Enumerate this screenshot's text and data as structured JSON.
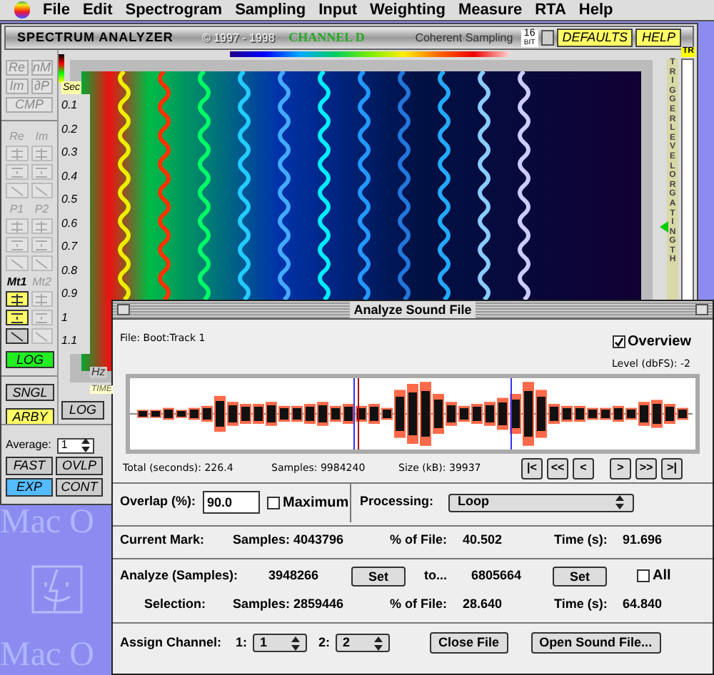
{
  "menu_bar": {
    "items": [
      "File",
      "Edit",
      "Spectrogram",
      "Sampling",
      "Input",
      "Weighting",
      "Measure",
      "RTA",
      "Help"
    ]
  },
  "analyzer": {
    "title": "SPECTRUM ANALYZER",
    "copyright": "© 1997 - 1998",
    "channel": "CHANNEL D",
    "mode": "Coherent Sampling",
    "bits": [
      "16",
      "BIT"
    ],
    "buttons": [
      "DEFAULTS",
      "HELP"
    ],
    "top_buttons": [
      [
        {
          "label": "Re",
          "disabled": true
        },
        {
          "label": "nM",
          "disabled": true
        }
      ],
      [
        {
          "label": "Im",
          "disabled": true
        },
        {
          "label": "∂P",
          "disabled": true
        }
      ],
      [
        {
          "label": "CMP",
          "disabled": true
        }
      ]
    ],
    "groups": [
      {
        "labels": [
          {
            "text": "Re",
            "disabled": true
          },
          {
            "text": "Im",
            "disabled": true
          }
        ],
        "rows": [
          [
            {
              "kind": "cross",
              "disabled": true,
              "on": false
            },
            {
              "kind": "cross",
              "disabled": true,
              "on": false
            }
          ],
          [
            {
              "kind": "dot",
              "disabled": true,
              "on": false
            },
            {
              "kind": "dot",
              "disabled": true,
              "on": false
            }
          ],
          [
            {
              "kind": "ramp",
              "disabled": true,
              "on": false
            },
            {
              "kind": "ramp",
              "disabled": true,
              "on": false
            }
          ]
        ]
      },
      {
        "labels": [
          {
            "text": "P1",
            "disabled": true
          },
          {
            "text": "P2",
            "disabled": true
          }
        ],
        "rows": [
          [
            {
              "kind": "cross",
              "disabled": true,
              "on": false
            },
            {
              "kind": "cross",
              "disabled": true,
              "on": false
            }
          ],
          [
            {
              "kind": "dot",
              "disabled": true,
              "on": false
            },
            {
              "kind": "dot",
              "disabled": true,
              "on": false
            }
          ],
          [
            {
              "kind": "ramp",
              "disabled": true,
              "on": false
            },
            {
              "kind": "ramp",
              "disabled": true,
              "on": false
            }
          ]
        ]
      },
      {
        "labels": [
          {
            "text": "Mt1",
            "disabled": false
          },
          {
            "text": "Mt2",
            "disabled": true
          }
        ],
        "rows": [
          [
            {
              "kind": "cross",
              "disabled": false,
              "on": true
            },
            {
              "kind": "cross",
              "disabled": true,
              "on": false
            }
          ],
          [
            {
              "kind": "dot",
              "disabled": false,
              "on": true
            },
            {
              "kind": "dot",
              "disabled": true,
              "on": false
            }
          ],
          [
            {
              "kind": "ramp",
              "disabled": false,
              "on": false
            },
            {
              "kind": "ramp",
              "disabled": true,
              "on": false
            }
          ]
        ]
      }
    ],
    "log_button": {
      "label": "LOG",
      "on": true,
      "color": "#22ee22"
    },
    "mode_buttons": [
      {
        "label": "SNGL",
        "on": false
      },
      {
        "label": "ARBY",
        "on": true,
        "color": "#ffff66"
      }
    ],
    "axis_unit": "Sec",
    "axis_labels": [
      "0.1",
      "0.2",
      "0.3",
      "0.4",
      "0.5",
      "0.6",
      "0.7",
      "0.8",
      "0.9",
      "1",
      "1.1"
    ],
    "freq_unit": "Hz",
    "time_label": "TIME",
    "scale_button": "LOG",
    "trigger_label": "TR",
    "trigger_text": "TRIGGER LEVEL OR GATING TH",
    "average": {
      "label": "Average:",
      "value": "1"
    },
    "bottom_buttons": [
      [
        {
          "label": "FAST",
          "on": false
        },
        {
          "label": "OVLP",
          "on": false
        }
      ],
      [
        {
          "label": "EXP",
          "on": true,
          "color": "#55bbff"
        },
        {
          "label": "CONT",
          "on": false
        }
      ]
    ]
  },
  "desktop": {
    "labels": [
      "Mac O",
      "Mac O"
    ]
  },
  "dialog": {
    "title": "Analyze Sound File",
    "file": "File: Boot:Track 1",
    "overview": {
      "label": "Overview",
      "checked": true
    },
    "level": "Level (dbFS): -2",
    "info": [
      "Total (seconds): 226.4",
      "Samples: 9984240",
      "Size (kB): 39937"
    ],
    "nav_buttons": [
      "|<",
      "<<",
      "<",
      ">",
      ">>",
      ">|"
    ],
    "overlap": {
      "label": "Overlap (%):",
      "value": "90.0"
    },
    "maximum": {
      "label": "Maximum",
      "checked": false
    },
    "processing": {
      "label": "Processing:",
      "value": "Loop"
    },
    "current_mark": {
      "label": "Current Mark:",
      "samples": "Samples: 4043796",
      "percent_label": "% of File:",
      "percent": "40.502",
      "time_label": "Time (s):",
      "time": "91.696"
    },
    "analyze": {
      "label": "Analyze (Samples):",
      "from": "3948266",
      "set": "Set",
      "to": "to...",
      "end": "6805664",
      "set2": "Set",
      "all": {
        "label": "All",
        "checked": false
      }
    },
    "selection": {
      "label": "Selection:",
      "samples": "Samples: 2859446",
      "percent_label": "% of File:",
      "percent": "28.640",
      "time_label": "Time (s):",
      "time": "64.840"
    },
    "assign": {
      "label": "Assign Channel:",
      "channels": [
        {
          "label": "1:",
          "value": "1"
        },
        {
          "label": "2:",
          "value": "2"
        }
      ]
    },
    "buttons": [
      "Close File",
      "Open Sound File..."
    ]
  }
}
